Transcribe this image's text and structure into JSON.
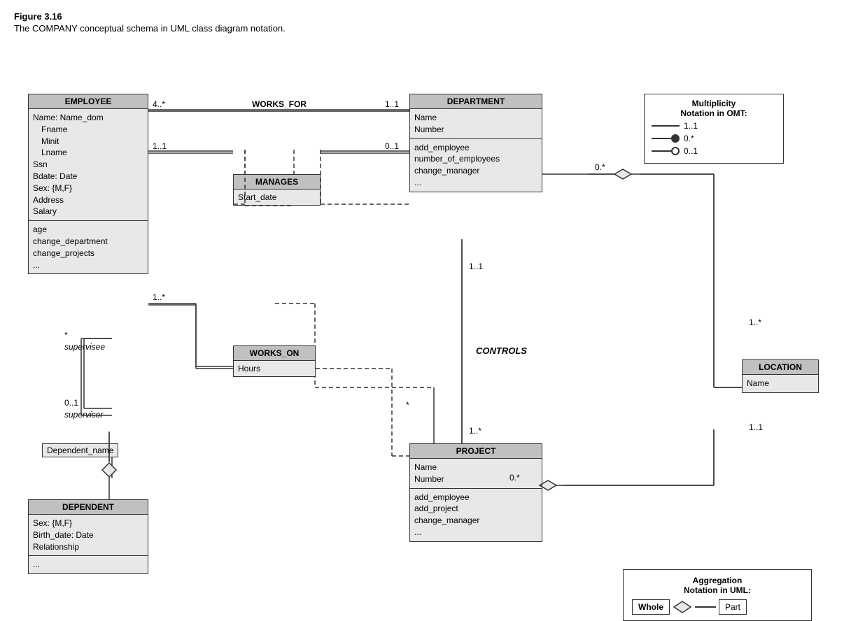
{
  "figure": {
    "title": "Figure 3.16",
    "caption": "The COMPANY conceptual schema in UML class diagram notation."
  },
  "classes": {
    "employee": {
      "name": "EMPLOYEE",
      "attributes": [
        "Name: Name_dom",
        "  Fname",
        "  Minit",
        "  Lname",
        "Ssn",
        "Bdate: Date",
        "Sex: {M,F}",
        "Address",
        "Salary"
      ],
      "methods": [
        "age",
        "change_department",
        "change_projects",
        "..."
      ],
      "extra": "Dependent_name"
    },
    "department": {
      "name": "DEPARTMENT",
      "attributes": [
        "Name",
        "Number"
      ],
      "methods": [
        "add_employee",
        "number_of_employees",
        "change_manager",
        "..."
      ]
    },
    "project": {
      "name": "PROJECT",
      "attributes": [
        "Name",
        "Number"
      ],
      "methods": [
        "add_employee",
        "add_project",
        "change_manager",
        "..."
      ]
    },
    "location": {
      "name": "LOCATION",
      "attributes": [
        "Name"
      ]
    },
    "dependent": {
      "name": "DEPENDENT",
      "attributes": [
        "Sex: {M,F}",
        "Birth_date: Date",
        "Relationship"
      ],
      "methods": [
        "..."
      ]
    }
  },
  "associations": {
    "manages": {
      "name": "MANAGES",
      "attributes": [
        "Start_date"
      ]
    },
    "works_on": {
      "name": "WORKS_ON",
      "attributes": [
        "Hours"
      ]
    }
  },
  "relationships": {
    "works_for": "WORKS_FOR",
    "controls": "CONTROLS"
  },
  "multiplicities": {
    "works_for_employee": "4..*",
    "works_for_department": "1..1",
    "manages_employee": "1..1",
    "manages_department": "0..1",
    "supervises_star": "*",
    "supervises_supervisee": "supervisee",
    "supervises_zero_one": "0..1",
    "supervises_supervisor": "supervisor",
    "supervises_one_star": "1..*",
    "works_on_employee": "1..*",
    "works_on_project": "*",
    "controls_department": "1..1",
    "controls_project": "1..*",
    "location_department": "0.*",
    "location_project": "0.*",
    "location_count": "1..*",
    "location_one_one": "1..1"
  },
  "notation_box": {
    "title": "Multiplicity",
    "subtitle": "Notation in OMT:",
    "rows": [
      {
        "type": "line",
        "label": "1..1"
      },
      {
        "type": "dot-filled",
        "label": "0.*"
      },
      {
        "type": "dot-open",
        "label": "0..1"
      }
    ]
  },
  "aggregation_box": {
    "title": "Aggregation",
    "subtitle": "Notation in UML:",
    "whole_label": "Whole",
    "part_label": "Part"
  }
}
